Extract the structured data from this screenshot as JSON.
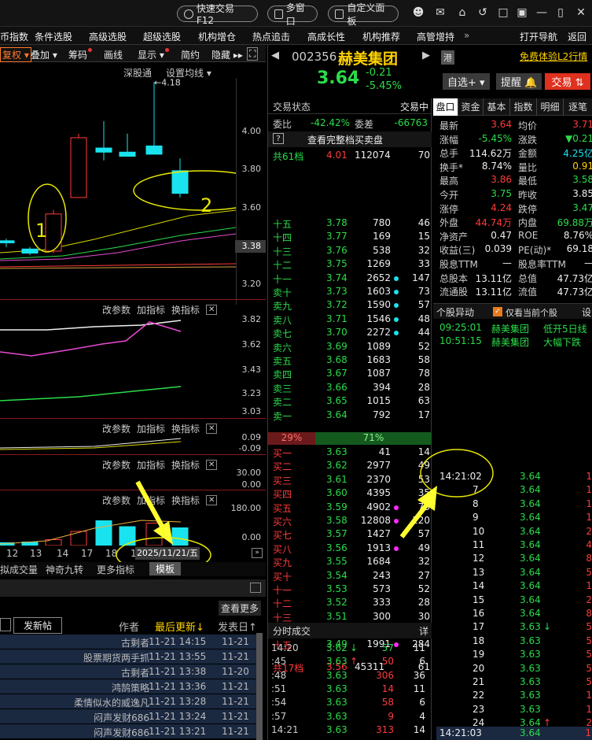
{
  "titlebar": {
    "quick_trade": "快速交易F12",
    "multi_window": "多窗口",
    "custom_panel": "自定义面板"
  },
  "menubar": {
    "items": [
      "币指数",
      "条件选股",
      "高级选股",
      "超级选股",
      "机构增仓",
      "热点追击",
      "高成长性",
      "机构推荐",
      "高管增持"
    ],
    "more": "»",
    "nav": "打开导航",
    "back": "返回"
  },
  "chart_toolbar": {
    "rights": "复权",
    "overlay": "叠加",
    "chips": "筹码",
    "draw": "画线",
    "display": "显示",
    "simple": "简约",
    "hide": "隐藏"
  },
  "chart": {
    "exchange_link": "深股通",
    "ma_setting": "设置均线",
    "price_axis": [
      "4.00",
      "3.80",
      "3.60",
      "3.38",
      "3.20"
    ],
    "max_label": "4.18",
    "annotation_1": "1",
    "annotation_2": "2",
    "indicator_btns": [
      "改参数",
      "加指标",
      "换指标"
    ],
    "macd_axis": [
      "3.82",
      "3.62",
      "3.43",
      "3.23",
      "3.03"
    ],
    "ind2_axis": [
      "0.09",
      "-0.09"
    ],
    "ind3_axis": [
      "30.00",
      "0.00"
    ],
    "vol_axis": [
      "180.00",
      "0.00"
    ],
    "x_dates": [
      "12",
      "13",
      "14",
      "17",
      "18",
      "1"
    ],
    "date_tooltip": "2025/11/21/五",
    "bottom_tabs": [
      "拟成交量",
      "神奇九转",
      "更多指标",
      "模板"
    ]
  },
  "chart_data": {
    "type": "candlestick",
    "title": "",
    "ylim": [
      3.1,
      4.2
    ],
    "candles": [
      {
        "x": "12",
        "open": 3.4,
        "high": 3.42,
        "low": 3.38,
        "close": 3.41,
        "color": "cyan"
      },
      {
        "x": "13",
        "open": 3.37,
        "high": 3.38,
        "low": 3.34,
        "close": 3.35,
        "color": "cyan"
      },
      {
        "x": "14",
        "open": 3.36,
        "high": 3.56,
        "low": 3.35,
        "close": 3.54,
        "color": "red"
      },
      {
        "x": "17",
        "open": 3.62,
        "high": 3.93,
        "low": 3.62,
        "close": 3.91,
        "color": "red"
      },
      {
        "x": "18",
        "open": 3.86,
        "high": 3.99,
        "low": 3.8,
        "close": 3.84,
        "color": "cyan"
      },
      {
        "x": "19",
        "open": 3.84,
        "high": 3.93,
        "low": 3.82,
        "close": 3.82,
        "color": "cyan"
      },
      {
        "x": "20",
        "open": 3.87,
        "high": 4.18,
        "low": 3.84,
        "close": 3.83,
        "color": "cyan"
      },
      {
        "x": "21",
        "open": 3.75,
        "high": 3.81,
        "low": 3.62,
        "close": 3.64,
        "color": "cyan"
      }
    ],
    "volume": [
      {
        "x": "12",
        "value": 12,
        "color": "cyan"
      },
      {
        "x": "13",
        "value": 15,
        "color": "cyan"
      },
      {
        "x": "14",
        "value": 25,
        "color": "red"
      },
      {
        "x": "17",
        "value": 60,
        "color": "red"
      },
      {
        "x": "18",
        "value": 105,
        "color": "cyan"
      },
      {
        "x": "19",
        "value": 80,
        "color": "cyan"
      },
      {
        "x": "20",
        "value": 95,
        "color": "red"
      },
      {
        "x": "21",
        "value": 75,
        "color": "cyan"
      }
    ],
    "vol_ylim": [
      0,
      180
    ]
  },
  "forum": {
    "more": "查看更多",
    "new_post": "发新帖",
    "headers": {
      "author": "作者",
      "last_update": "最后更新↓",
      "post_date": "发表日↑"
    },
    "rows": [
      {
        "author": "古剩者",
        "update": "11-21 14:15",
        "date": "11-21"
      },
      {
        "author": "股票期货两手抓",
        "update": "11-21 13:55",
        "date": "11-21"
      },
      {
        "author": "古剩者",
        "update": "11-21 13:38",
        "date": "11-20"
      },
      {
        "author": "鸿鹄策略",
        "update": "11-21 13:36",
        "date": "11-21"
      },
      {
        "author": "柔情似水的威逸凡",
        "update": "11-21 13:28",
        "date": "11-21"
      },
      {
        "author": "闷声发财686",
        "update": "11-21 13:24",
        "date": "11-21"
      },
      {
        "author": "闷声发财686",
        "update": "11-21 13:21",
        "date": "11-21"
      }
    ]
  },
  "stock": {
    "code": "002356",
    "name": "赫美集团",
    "price": "3.64",
    "change": "-0.21",
    "change_pct": "-5.45%",
    "hk_badge": "港",
    "l2_link": "免费体验L2行情",
    "watchlist": "自选+",
    "alert": "提醒",
    "trade": "交易"
  },
  "orderbook": {
    "status_label": "交易状态",
    "status_value": "交易中",
    "weibi_label": "委比",
    "weibi": "-42.42%",
    "weicha_label": "委差",
    "weicha": "-66763",
    "full_book": "查看完整档买卖盘",
    "total_sell": {
      "label": "共61档",
      "price": "4.01",
      "vol": "112074",
      "count": "70"
    },
    "sells": [
      {
        "label": "十五",
        "price": "3.78",
        "vol": "780",
        "count": "46",
        "dot": ""
      },
      {
        "label": "十四",
        "price": "3.77",
        "vol": "169",
        "count": "15",
        "dot": ""
      },
      {
        "label": "十三",
        "price": "3.76",
        "vol": "538",
        "count": "32",
        "dot": ""
      },
      {
        "label": "十二",
        "price": "3.75",
        "vol": "1269",
        "count": "33",
        "dot": ""
      },
      {
        "label": "十一",
        "price": "3.74",
        "vol": "2652",
        "count": "147",
        "dot": "cy"
      },
      {
        "label": "卖十",
        "price": "3.73",
        "vol": "1603",
        "count": "73",
        "dot": "cy"
      },
      {
        "label": "卖九",
        "price": "3.72",
        "vol": "1590",
        "count": "57",
        "dot": "cy"
      },
      {
        "label": "卖八",
        "price": "3.71",
        "vol": "1546",
        "count": "48",
        "dot": "cy"
      },
      {
        "label": "卖七",
        "price": "3.70",
        "vol": "2272",
        "count": "44",
        "dot": "cy"
      },
      {
        "label": "卖六",
        "price": "3.69",
        "vol": "1089",
        "count": "52",
        "dot": ""
      },
      {
        "label": "卖五",
        "price": "3.68",
        "vol": "1683",
        "count": "58",
        "dot": ""
      },
      {
        "label": "卖四",
        "price": "3.67",
        "vol": "1087",
        "count": "78",
        "dot": ""
      },
      {
        "label": "卖三",
        "price": "3.66",
        "vol": "394",
        "count": "28",
        "dot": ""
      },
      {
        "label": "卖二",
        "price": "3.65",
        "vol": "1015",
        "count": "63",
        "dot": ""
      },
      {
        "label": "卖一",
        "price": "3.64",
        "vol": "792",
        "count": "17",
        "dot": ""
      }
    ],
    "ratio_sell": "29%",
    "ratio_buy": "71%",
    "buys": [
      {
        "label": "买一",
        "price": "3.63",
        "vol": "41",
        "count": "14",
        "dot": ""
      },
      {
        "label": "买二",
        "price": "3.62",
        "vol": "2977",
        "count": "49",
        "dot": ""
      },
      {
        "label": "买三",
        "price": "3.61",
        "vol": "2370",
        "count": "53",
        "dot": ""
      },
      {
        "label": "买四",
        "price": "3.60",
        "vol": "4395",
        "count": "35",
        "dot": ""
      },
      {
        "label": "买五",
        "price": "3.59",
        "vol": "4902",
        "count": "73",
        "dot": "mg"
      },
      {
        "label": "买六",
        "price": "3.58",
        "vol": "12808",
        "count": "120",
        "dot": "mg"
      },
      {
        "label": "买七",
        "price": "3.57",
        "vol": "1427",
        "count": "57",
        "dot": ""
      },
      {
        "label": "买八",
        "price": "3.56",
        "vol": "1913",
        "count": "49",
        "dot": "mg"
      },
      {
        "label": "买九",
        "price": "3.55",
        "vol": "1684",
        "count": "32",
        "dot": ""
      },
      {
        "label": "买十",
        "price": "3.54",
        "vol": "243",
        "count": "27",
        "dot": ""
      },
      {
        "label": "十一",
        "price": "3.53",
        "vol": "573",
        "count": "52",
        "dot": ""
      },
      {
        "label": "十二",
        "price": "3.52",
        "vol": "333",
        "count": "28",
        "dot": ""
      },
      {
        "label": "十三",
        "price": "3.51",
        "vol": "300",
        "count": "30",
        "dot": ""
      },
      {
        "label": "十四",
        "price": "3.50",
        "vol": "1652",
        "count": "32",
        "dot": ""
      },
      {
        "label": "十五",
        "price": "3.49",
        "vol": "1991",
        "count": "284",
        "dot": "mg"
      }
    ],
    "total_buy": {
      "label": "共17档",
      "price": "3.56",
      "vol": "45311",
      "count": "61"
    }
  },
  "ticks_left": {
    "header": "分时成交",
    "detail": "详",
    "rows": [
      {
        "time": "14:20",
        "price": "3.62",
        "arrow": "↓",
        "vol": "57",
        "count": "11"
      },
      {
        "time": ":45",
        "price": "3.63",
        "arrow": "↑",
        "vol": "50",
        "count": "6"
      },
      {
        "time": ":48",
        "price": "3.63",
        "arrow": "",
        "vol": "306",
        "count": "36"
      },
      {
        "time": ":51",
        "price": "3.63",
        "arrow": "",
        "vol": "14",
        "count": "11"
      },
      {
        "time": ":54",
        "price": "3.63",
        "arrow": "",
        "vol": "58",
        "count": "6"
      },
      {
        "time": ":57",
        "price": "3.63",
        "arrow": "",
        "vol": "9",
        "count": "4"
      },
      {
        "time": "14:21",
        "price": "3.63",
        "arrow": "",
        "vol": "313",
        "count": "14"
      }
    ]
  },
  "quote_tabs": [
    "盘口",
    "资金",
    "基本",
    "指数",
    "明细",
    "逐笔"
  ],
  "quote": [
    {
      "l1": "最新",
      "v1": "3.64",
      "c1": "up",
      "l2": "均价",
      "v2": "3.71",
      "c2": "up"
    },
    {
      "l1": "涨幅",
      "v1": "-5.45%",
      "c1": "dn",
      "l2": "涨跌",
      "v2": "▼0.21",
      "c2": "dn"
    },
    {
      "l1": "总手",
      "v1": "114.62万",
      "c1": "wh",
      "l2": "金额",
      "v2": "4.25亿",
      "c2": "cy"
    },
    {
      "l1": "换手*",
      "v1": "8.74%",
      "c1": "wh",
      "l2": "量比",
      "v2": "0.91",
      "c2": "yl"
    },
    {
      "l1": "最高",
      "v1": "3.86",
      "c1": "up",
      "l2": "最低",
      "v2": "3.58",
      "c2": "dn"
    },
    {
      "l1": "今开",
      "v1": "3.75",
      "c1": "dn",
      "l2": "昨收",
      "v2": "3.85",
      "c2": "wh"
    },
    {
      "l1": "涨停",
      "v1": "4.24",
      "c1": "up",
      "l2": "跌停",
      "v2": "3.47",
      "c2": "dn"
    },
    {
      "l1": "外盘",
      "v1": "44.74万",
      "c1": "up",
      "l2": "内盘",
      "v2": "69.88万",
      "c2": "dn"
    },
    {
      "l1": "净资产",
      "v1": "0.47",
      "c1": "wh",
      "l2": "ROE",
      "v2": "8.76%",
      "c2": "wh"
    },
    {
      "l1": "收益(三)",
      "v1": "0.039",
      "c1": "wh",
      "l2": "PE(动)*",
      "v2": "69.18",
      "c2": "wh"
    },
    {
      "l1": "股息TTM",
      "v1": "—",
      "c1": "wh",
      "l2": "股息率TTM",
      "v2": "—",
      "c2": "wh"
    },
    {
      "l1": "总股本",
      "v1": "13.11亿",
      "c1": "wh",
      "l2": "总值",
      "v2": "47.73亿",
      "c2": "wh"
    },
    {
      "l1": "流通股",
      "v1": "13.11亿",
      "c1": "wh",
      "l2": "流值",
      "v2": "47.73亿",
      "c2": "wh"
    }
  ],
  "alerts": {
    "title": "个股异动",
    "only_current": "仅看当前个股",
    "settings": "设",
    "rows": [
      {
        "time": "09:25:01",
        "name": "赫美集团",
        "event": "低开5日线"
      },
      {
        "time": "10:51:15",
        "name": "赫美集团",
        "event": "大幅下跌"
      }
    ]
  },
  "ticks_right": {
    "rows": [
      {
        "time": "14:21:02",
        "price": "3.64",
        "arrow": "",
        "tail": "1"
      },
      {
        "time": "7",
        "price": "3.64",
        "arrow": "",
        "tail": "1"
      },
      {
        "time": "8",
        "price": "3.64",
        "arrow": "",
        "tail": "1"
      },
      {
        "time": "9",
        "price": "3.64",
        "arrow": "",
        "tail": "1"
      },
      {
        "time": "10",
        "price": "3.64",
        "arrow": "",
        "tail": "2"
      },
      {
        "time": "11",
        "price": "3.64",
        "arrow": "",
        "tail": "4"
      },
      {
        "time": "12",
        "price": "3.64",
        "arrow": "",
        "tail": "8"
      },
      {
        "time": "13",
        "price": "3.64",
        "arrow": "",
        "tail": "5"
      },
      {
        "time": "14",
        "price": "3.64",
        "arrow": "",
        "tail": "1"
      },
      {
        "time": "15",
        "price": "3.64",
        "arrow": "",
        "tail": "2"
      },
      {
        "time": "16",
        "price": "3.64",
        "arrow": "",
        "tail": "8"
      },
      {
        "time": "17",
        "price": "3.63",
        "arrow": "↓",
        "tail": "5"
      },
      {
        "time": "18",
        "price": "3.63",
        "arrow": "",
        "tail": "5"
      },
      {
        "time": "19",
        "price": "3.63",
        "arrow": "",
        "tail": "5"
      },
      {
        "time": "20",
        "price": "3.63",
        "arrow": "",
        "tail": "5"
      },
      {
        "time": "21",
        "price": "3.63",
        "arrow": "",
        "tail": "5"
      },
      {
        "time": "22",
        "price": "3.63",
        "arrow": "",
        "tail": "1"
      },
      {
        "time": "23",
        "price": "3.63",
        "arrow": "",
        "tail": "1"
      },
      {
        "time": "24",
        "price": "3.64",
        "arrow": "↑",
        "tail": "2"
      },
      {
        "time": "14:21:03",
        "price": "3.64",
        "arrow": "",
        "tail": "1"
      }
    ]
  },
  "colors": {
    "up": "#ff3b3b",
    "down": "#2bdc4a",
    "accent": "#ffd200",
    "cyan": "#19e3ee"
  }
}
